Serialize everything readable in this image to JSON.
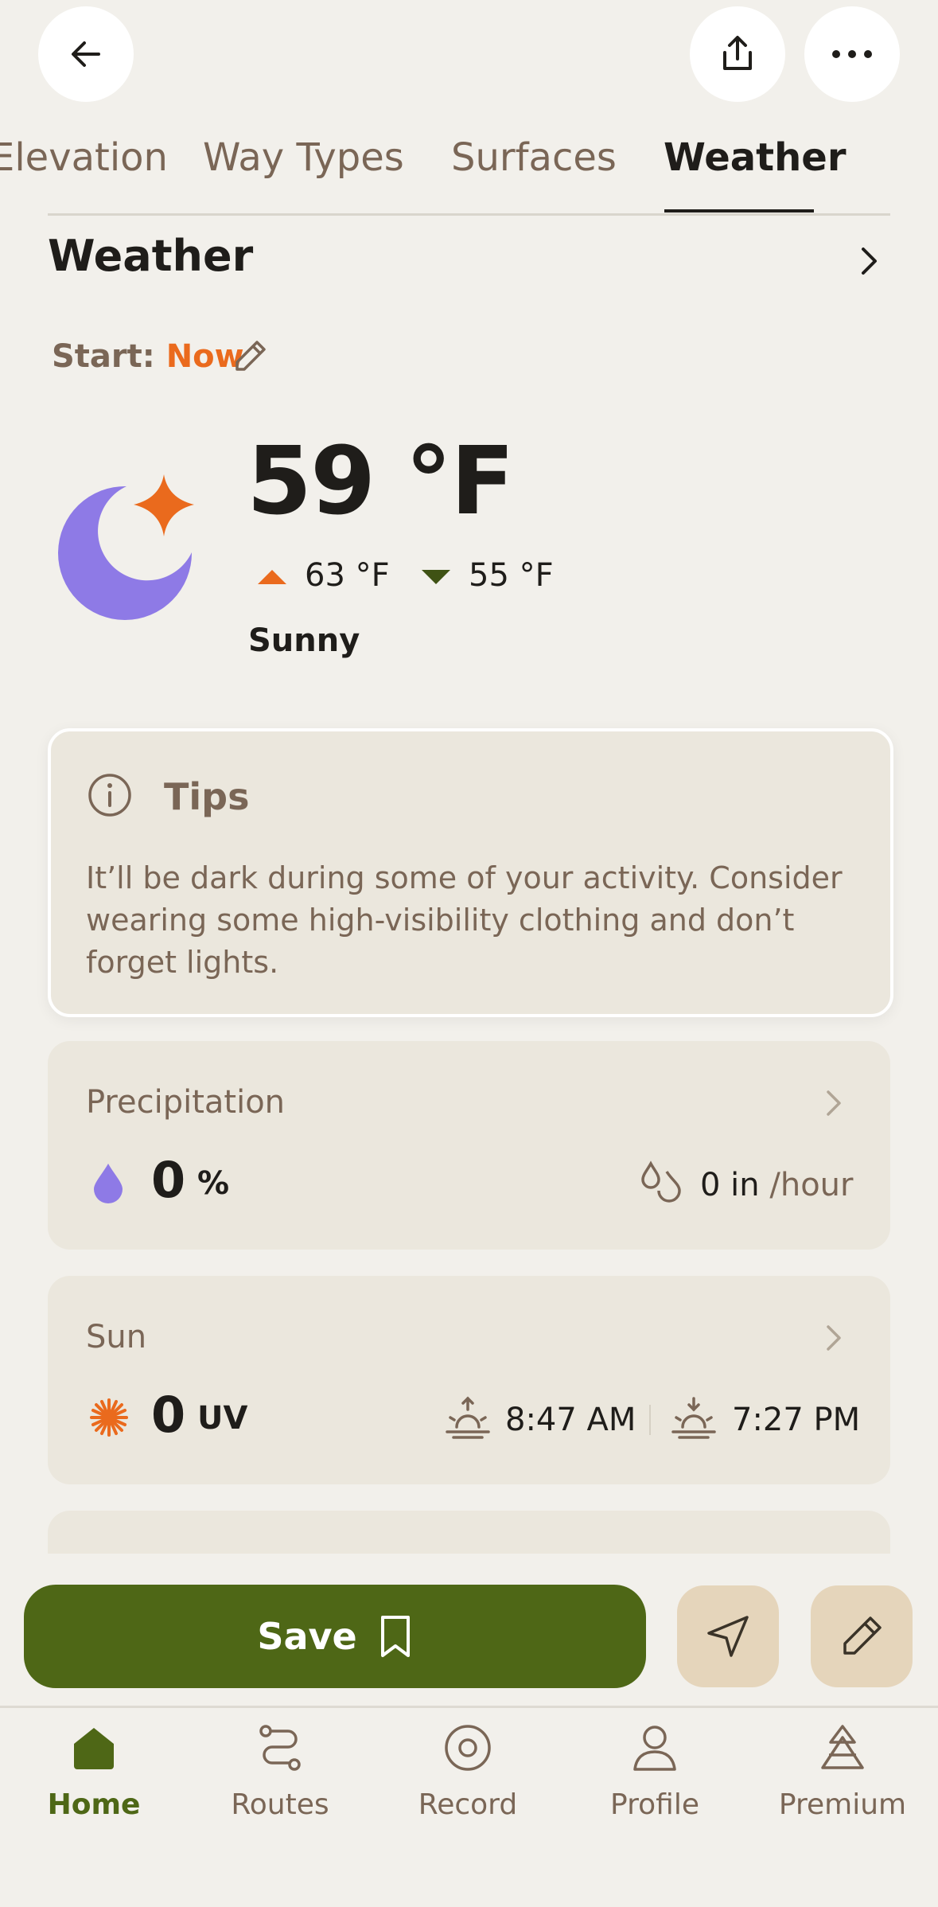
{
  "top_bar": {
    "back_icon": "arrow-left-icon",
    "share_icon": "share-icon",
    "more_icon": "ellipsis-icon"
  },
  "tabs": [
    {
      "label": "Elevation",
      "active": false
    },
    {
      "label": "Way Types",
      "active": false
    },
    {
      "label": "Surfaces",
      "active": false
    },
    {
      "label": "Weather",
      "active": true
    }
  ],
  "weather": {
    "title": "Weather",
    "start_label": "Start:",
    "start_value": "Now",
    "temperature": "59 °F",
    "high": "63 °F",
    "low": "55 °F",
    "condition": "Sunny",
    "condition_icon": "moon-star-icon"
  },
  "tips": {
    "title": "Tips",
    "text": "It’ll be dark during some of your activity. Consider wearing some high-visibility clothing and don’t forget lights."
  },
  "precipitation": {
    "label": "Precipitation",
    "value": "0",
    "unit": "%",
    "amount": "0 in",
    "amount_unit": "/hour"
  },
  "sun": {
    "label": "Sun",
    "uv_value": "0",
    "uv_unit": "UV",
    "sunrise": "8:47 AM",
    "sunset": "7:27 PM"
  },
  "actions": {
    "save_label": "Save"
  },
  "bottom_nav": [
    {
      "label": "Home",
      "active": true
    },
    {
      "label": "Routes",
      "active": false
    },
    {
      "label": "Record",
      "active": false
    },
    {
      "label": "Profile",
      "active": false
    },
    {
      "label": "Premium",
      "active": false
    }
  ],
  "colors": {
    "background": "#f2f0eb",
    "accent_orange": "#ea6a1d",
    "brand_green": "#4e6716",
    "moon_purple": "#8e7ae6",
    "muted_brown": "#7a6656"
  }
}
